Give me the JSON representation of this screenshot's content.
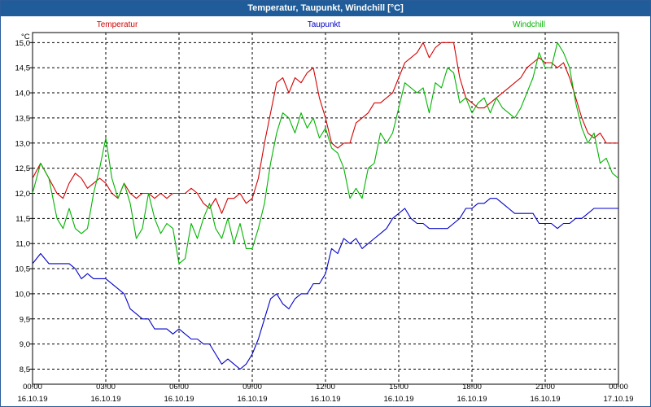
{
  "window": {
    "title": "Temperatur, Taupunkt, Windchill [°C]"
  },
  "chart_data": {
    "type": "line",
    "title": "Temperatur, Taupunkt, Windchill [°C]",
    "ylabel": "°C",
    "ylim": [
      8.2,
      15.2
    ],
    "yticks": [
      "15,0",
      "14,5",
      "14,0",
      "13,5",
      "13,0",
      "12,5",
      "12,0",
      "11,5",
      "11,0",
      "10,5",
      "10,0",
      "9,5",
      "9,0",
      "8,5"
    ],
    "xticks": [
      {
        "time": "00:00",
        "date": "16.10.19"
      },
      {
        "time": "03:00",
        "date": "16.10.19"
      },
      {
        "time": "06:00",
        "date": "16.10.19"
      },
      {
        "time": "09:00",
        "date": "16.10.19"
      },
      {
        "time": "12:00",
        "date": "16.10.19"
      },
      {
        "time": "15:00",
        "date": "16.10.19"
      },
      {
        "time": "18:00",
        "date": "16.10.19"
      },
      {
        "time": "21:00",
        "date": "16.10.19"
      },
      {
        "time": "00:00",
        "date": "17.10.19"
      }
    ],
    "grid": true,
    "legend_position": "top",
    "series": [
      {
        "name": "Temperatur",
        "color": "#d40000",
        "points": [
          [
            0,
            12.3
          ],
          [
            0.33,
            12.6
          ],
          [
            0.67,
            12.3
          ],
          [
            1,
            12.0
          ],
          [
            1.25,
            11.9
          ],
          [
            1.5,
            12.2
          ],
          [
            1.75,
            12.4
          ],
          [
            2,
            12.3
          ],
          [
            2.25,
            12.1
          ],
          [
            2.5,
            12.2
          ],
          [
            2.75,
            12.3
          ],
          [
            3,
            12.2
          ],
          [
            3.25,
            12.0
          ],
          [
            3.5,
            11.9
          ],
          [
            3.75,
            12.2
          ],
          [
            4,
            12.0
          ],
          [
            4.25,
            11.9
          ],
          [
            4.5,
            12.0
          ],
          [
            4.75,
            12.0
          ],
          [
            5,
            11.9
          ],
          [
            5.25,
            12.0
          ],
          [
            5.5,
            11.9
          ],
          [
            5.75,
            12.0
          ],
          [
            6,
            12.0
          ],
          [
            6.25,
            12.0
          ],
          [
            6.5,
            12.1
          ],
          [
            6.75,
            12.0
          ],
          [
            7,
            11.8
          ],
          [
            7.25,
            11.7
          ],
          [
            7.5,
            11.9
          ],
          [
            7.75,
            11.6
          ],
          [
            8,
            11.9
          ],
          [
            8.25,
            11.9
          ],
          [
            8.5,
            12.0
          ],
          [
            8.75,
            11.8
          ],
          [
            9,
            11.9
          ],
          [
            9.25,
            12.3
          ],
          [
            9.5,
            13.0
          ],
          [
            9.75,
            13.6
          ],
          [
            10,
            14.2
          ],
          [
            10.25,
            14.3
          ],
          [
            10.5,
            14.0
          ],
          [
            10.75,
            14.3
          ],
          [
            11,
            14.2
          ],
          [
            11.25,
            14.4
          ],
          [
            11.5,
            14.5
          ],
          [
            11.75,
            13.9
          ],
          [
            12,
            13.5
          ],
          [
            12.25,
            13.0
          ],
          [
            12.5,
            12.9
          ],
          [
            12.75,
            13.0
          ],
          [
            13,
            13.0
          ],
          [
            13.25,
            13.4
          ],
          [
            13.5,
            13.5
          ],
          [
            13.75,
            13.6
          ],
          [
            14,
            13.8
          ],
          [
            14.25,
            13.8
          ],
          [
            14.5,
            13.9
          ],
          [
            14.75,
            14.0
          ],
          [
            15,
            14.3
          ],
          [
            15.25,
            14.6
          ],
          [
            15.5,
            14.7
          ],
          [
            15.75,
            14.8
          ],
          [
            16,
            15.0
          ],
          [
            16.25,
            14.7
          ],
          [
            16.5,
            14.9
          ],
          [
            16.75,
            15.0
          ],
          [
            17,
            15.0
          ],
          [
            17.25,
            15.0
          ],
          [
            17.5,
            14.3
          ],
          [
            17.75,
            13.9
          ],
          [
            18,
            13.8
          ],
          [
            18.25,
            13.7
          ],
          [
            18.5,
            13.7
          ],
          [
            18.75,
            13.8
          ],
          [
            19,
            13.9
          ],
          [
            19.25,
            14.0
          ],
          [
            19.5,
            14.1
          ],
          [
            19.75,
            14.2
          ],
          [
            20,
            14.3
          ],
          [
            20.25,
            14.5
          ],
          [
            20.5,
            14.6
          ],
          [
            20.75,
            14.7
          ],
          [
            21,
            14.6
          ],
          [
            21.25,
            14.6
          ],
          [
            21.5,
            14.5
          ],
          [
            21.75,
            14.6
          ],
          [
            22,
            14.3
          ],
          [
            22.25,
            13.9
          ],
          [
            22.5,
            13.5
          ],
          [
            22.75,
            13.2
          ],
          [
            23,
            13.1
          ],
          [
            23.25,
            13.2
          ],
          [
            23.5,
            13.0
          ],
          [
            23.75,
            13.0
          ],
          [
            24,
            13.0
          ]
        ]
      },
      {
        "name": "Taupunkt",
        "color": "#0000c8",
        "points": [
          [
            0,
            10.6
          ],
          [
            0.33,
            10.8
          ],
          [
            0.67,
            10.6
          ],
          [
            1,
            10.6
          ],
          [
            1.5,
            10.6
          ],
          [
            1.75,
            10.5
          ],
          [
            2,
            10.3
          ],
          [
            2.25,
            10.4
          ],
          [
            2.5,
            10.3
          ],
          [
            2.75,
            10.3
          ],
          [
            3,
            10.3
          ],
          [
            3.25,
            10.2
          ],
          [
            3.5,
            10.1
          ],
          [
            3.75,
            10.0
          ],
          [
            4,
            9.7
          ],
          [
            4.25,
            9.6
          ],
          [
            4.5,
            9.5
          ],
          [
            4.75,
            9.5
          ],
          [
            5,
            9.3
          ],
          [
            5.25,
            9.3
          ],
          [
            5.5,
            9.3
          ],
          [
            5.75,
            9.2
          ],
          [
            6,
            9.3
          ],
          [
            6.25,
            9.2
          ],
          [
            6.5,
            9.1
          ],
          [
            6.75,
            9.1
          ],
          [
            7,
            9.0
          ],
          [
            7.25,
            9.0
          ],
          [
            7.5,
            8.8
          ],
          [
            7.75,
            8.6
          ],
          [
            8,
            8.7
          ],
          [
            8.25,
            8.6
          ],
          [
            8.5,
            8.5
          ],
          [
            8.75,
            8.6
          ],
          [
            9,
            8.8
          ],
          [
            9.25,
            9.1
          ],
          [
            9.5,
            9.5
          ],
          [
            9.75,
            9.9
          ],
          [
            10,
            10.0
          ],
          [
            10.25,
            9.8
          ],
          [
            10.5,
            9.7
          ],
          [
            10.75,
            9.9
          ],
          [
            11,
            10.0
          ],
          [
            11.25,
            10.0
          ],
          [
            11.5,
            10.2
          ],
          [
            11.75,
            10.2
          ],
          [
            12,
            10.4
          ],
          [
            12.25,
            10.9
          ],
          [
            12.5,
            10.8
          ],
          [
            12.75,
            11.1
          ],
          [
            13,
            11.0
          ],
          [
            13.25,
            11.1
          ],
          [
            13.5,
            10.9
          ],
          [
            13.75,
            11.0
          ],
          [
            14,
            11.1
          ],
          [
            14.25,
            11.2
          ],
          [
            14.5,
            11.3
          ],
          [
            14.75,
            11.5
          ],
          [
            15,
            11.6
          ],
          [
            15.25,
            11.7
          ],
          [
            15.5,
            11.5
          ],
          [
            15.75,
            11.4
          ],
          [
            16,
            11.4
          ],
          [
            16.25,
            11.3
          ],
          [
            16.5,
            11.3
          ],
          [
            16.75,
            11.3
          ],
          [
            17,
            11.3
          ],
          [
            17.25,
            11.4
          ],
          [
            17.5,
            11.5
          ],
          [
            17.75,
            11.7
          ],
          [
            18,
            11.7
          ],
          [
            18.25,
            11.8
          ],
          [
            18.5,
            11.8
          ],
          [
            18.75,
            11.9
          ],
          [
            19,
            11.9
          ],
          [
            19.25,
            11.8
          ],
          [
            19.5,
            11.7
          ],
          [
            19.75,
            11.6
          ],
          [
            20,
            11.6
          ],
          [
            20.25,
            11.6
          ],
          [
            20.5,
            11.6
          ],
          [
            20.75,
            11.4
          ],
          [
            21,
            11.4
          ],
          [
            21.25,
            11.4
          ],
          [
            21.5,
            11.3
          ],
          [
            21.75,
            11.4
          ],
          [
            22,
            11.4
          ],
          [
            22.25,
            11.5
          ],
          [
            22.5,
            11.5
          ],
          [
            22.75,
            11.6
          ],
          [
            23,
            11.7
          ],
          [
            23.25,
            11.7
          ],
          [
            23.5,
            11.7
          ],
          [
            23.75,
            11.7
          ],
          [
            24,
            11.7
          ]
        ]
      },
      {
        "name": "Windchill",
        "color": "#00b400",
        "points": [
          [
            0,
            12.0
          ],
          [
            0.33,
            12.6
          ],
          [
            0.67,
            12.3
          ],
          [
            1,
            11.5
          ],
          [
            1.25,
            11.3
          ],
          [
            1.5,
            11.7
          ],
          [
            1.75,
            11.3
          ],
          [
            2,
            11.2
          ],
          [
            2.25,
            11.3
          ],
          [
            2.5,
            12.0
          ],
          [
            2.75,
            12.5
          ],
          [
            3,
            13.1
          ],
          [
            3.25,
            12.3
          ],
          [
            3.5,
            11.9
          ],
          [
            3.75,
            12.2
          ],
          [
            4,
            11.8
          ],
          [
            4.25,
            11.1
          ],
          [
            4.5,
            11.3
          ],
          [
            4.75,
            12.0
          ],
          [
            5,
            11.5
          ],
          [
            5.25,
            11.2
          ],
          [
            5.5,
            11.4
          ],
          [
            5.75,
            11.3
          ],
          [
            6,
            10.6
          ],
          [
            6.25,
            10.7
          ],
          [
            6.5,
            11.4
          ],
          [
            6.75,
            11.1
          ],
          [
            7,
            11.5
          ],
          [
            7.25,
            11.8
          ],
          [
            7.5,
            11.3
          ],
          [
            7.75,
            11.1
          ],
          [
            8,
            11.5
          ],
          [
            8.25,
            11.0
          ],
          [
            8.5,
            11.4
          ],
          [
            8.75,
            10.9
          ],
          [
            9,
            10.9
          ],
          [
            9.25,
            11.3
          ],
          [
            9.5,
            11.8
          ],
          [
            9.75,
            12.6
          ],
          [
            10,
            13.2
          ],
          [
            10.25,
            13.6
          ],
          [
            10.5,
            13.5
          ],
          [
            10.75,
            13.2
          ],
          [
            11,
            13.6
          ],
          [
            11.25,
            13.3
          ],
          [
            11.5,
            13.5
          ],
          [
            11.75,
            13.1
          ],
          [
            12,
            13.3
          ],
          [
            12.25,
            12.9
          ],
          [
            12.5,
            12.8
          ],
          [
            12.75,
            12.5
          ],
          [
            13,
            11.9
          ],
          [
            13.25,
            12.1
          ],
          [
            13.5,
            11.9
          ],
          [
            13.75,
            12.5
          ],
          [
            14,
            12.6
          ],
          [
            14.25,
            13.2
          ],
          [
            14.5,
            13.0
          ],
          [
            14.75,
            13.2
          ],
          [
            15,
            13.7
          ],
          [
            15.25,
            14.2
          ],
          [
            15.5,
            14.1
          ],
          [
            15.75,
            14.0
          ],
          [
            16,
            14.1
          ],
          [
            16.25,
            13.6
          ],
          [
            16.5,
            14.2
          ],
          [
            16.75,
            14.1
          ],
          [
            17,
            14.5
          ],
          [
            17.25,
            14.4
          ],
          [
            17.5,
            13.8
          ],
          [
            17.75,
            13.9
          ],
          [
            18,
            13.6
          ],
          [
            18.25,
            13.8
          ],
          [
            18.5,
            13.9
          ],
          [
            18.75,
            13.6
          ],
          [
            19,
            13.9
          ],
          [
            19.25,
            13.7
          ],
          [
            19.5,
            13.6
          ],
          [
            19.75,
            13.5
          ],
          [
            20,
            13.7
          ],
          [
            20.25,
            14.0
          ],
          [
            20.5,
            14.3
          ],
          [
            20.75,
            14.8
          ],
          [
            21,
            14.5
          ],
          [
            21.25,
            14.5
          ],
          [
            21.5,
            15.0
          ],
          [
            21.75,
            14.8
          ],
          [
            22,
            14.5
          ],
          [
            22.25,
            13.8
          ],
          [
            22.5,
            13.3
          ],
          [
            22.75,
            13.0
          ],
          [
            23,
            13.2
          ],
          [
            23.25,
            12.6
          ],
          [
            23.5,
            12.7
          ],
          [
            23.75,
            12.4
          ],
          [
            24,
            12.3
          ]
        ]
      }
    ]
  }
}
